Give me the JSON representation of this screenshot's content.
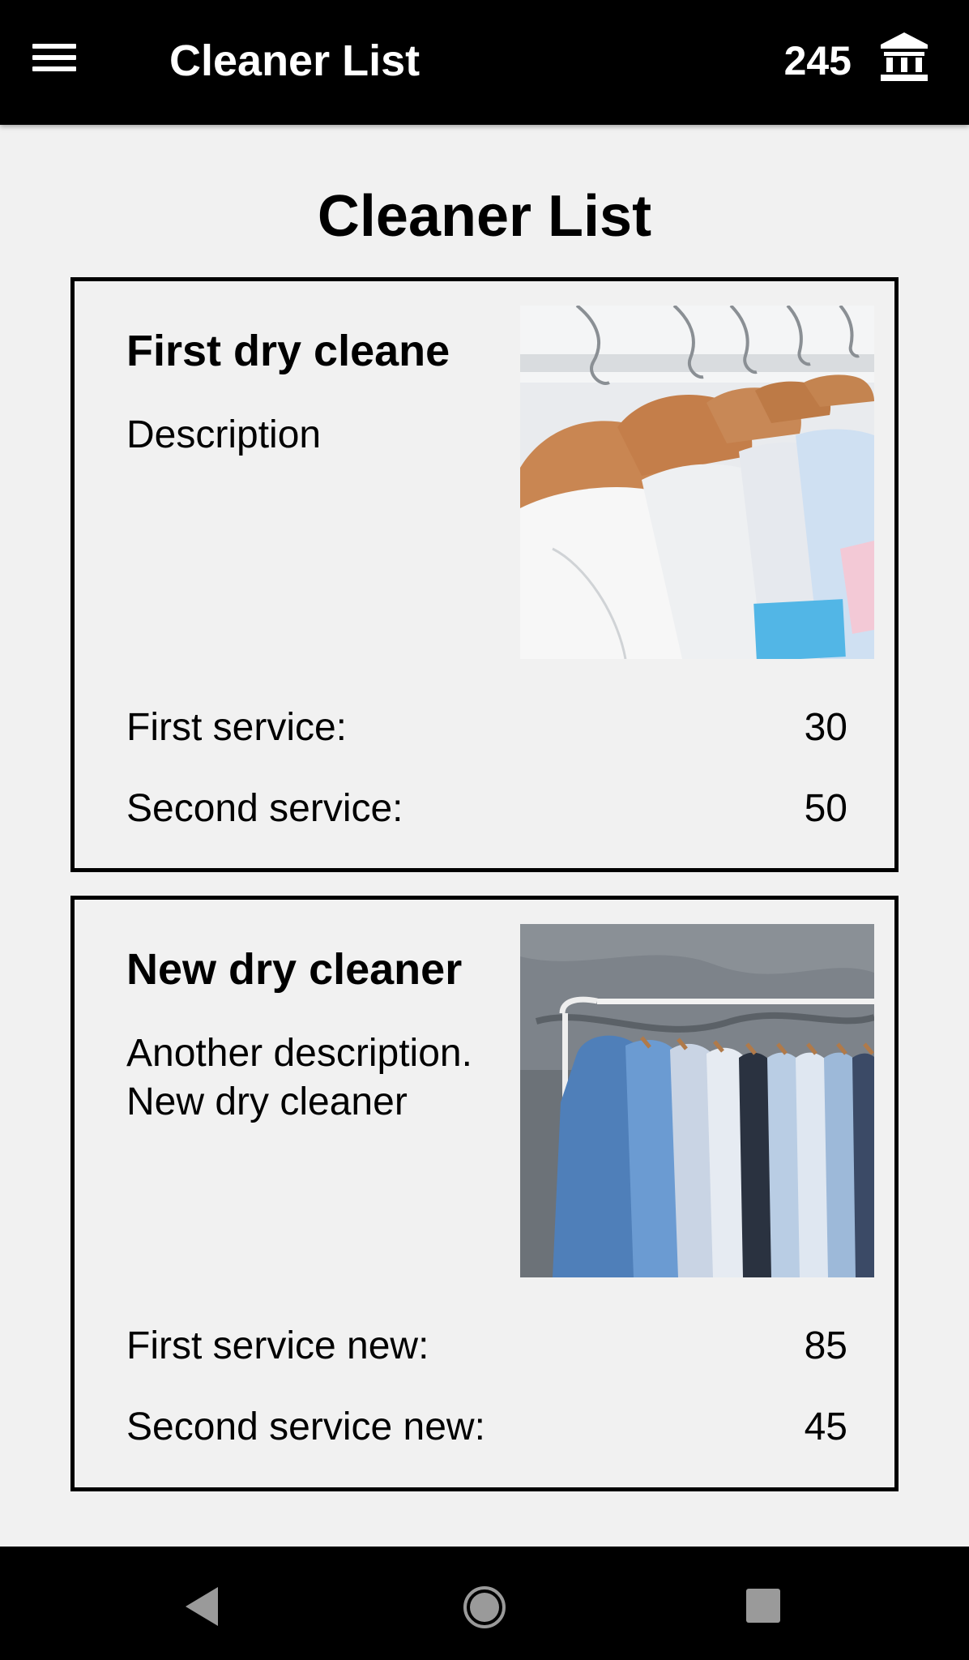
{
  "app_bar": {
    "title": "Cleaner List",
    "balance": "245",
    "menu_icon": "hamburger-menu-icon",
    "bank_icon": "bank-icon"
  },
  "page": {
    "title": "Cleaner List"
  },
  "cleaners": [
    {
      "name": "First dry cleane",
      "description": "Description",
      "photo": "dry-cleaning-hangers-photo",
      "services": [
        {
          "label": "First service:",
          "value": "30"
        },
        {
          "label": "Second service:",
          "value": "50"
        }
      ]
    },
    {
      "name": "New dry cleaner",
      "description": "Another description. New dry cleaner",
      "photo": "clothing-rack-photo",
      "services": [
        {
          "label": "First service new:",
          "value": "85"
        },
        {
          "label": "Second service new:",
          "value": "45"
        }
      ]
    }
  ],
  "nav_bar": {
    "back_icon": "back-triangle-icon",
    "home_icon": "home-circle-icon",
    "recents_icon": "recents-square-icon"
  },
  "colors": {
    "app_bar_bg": "#000000",
    "page_bg": "#f1f1f1",
    "card_border": "#000000",
    "text": "#000000"
  }
}
